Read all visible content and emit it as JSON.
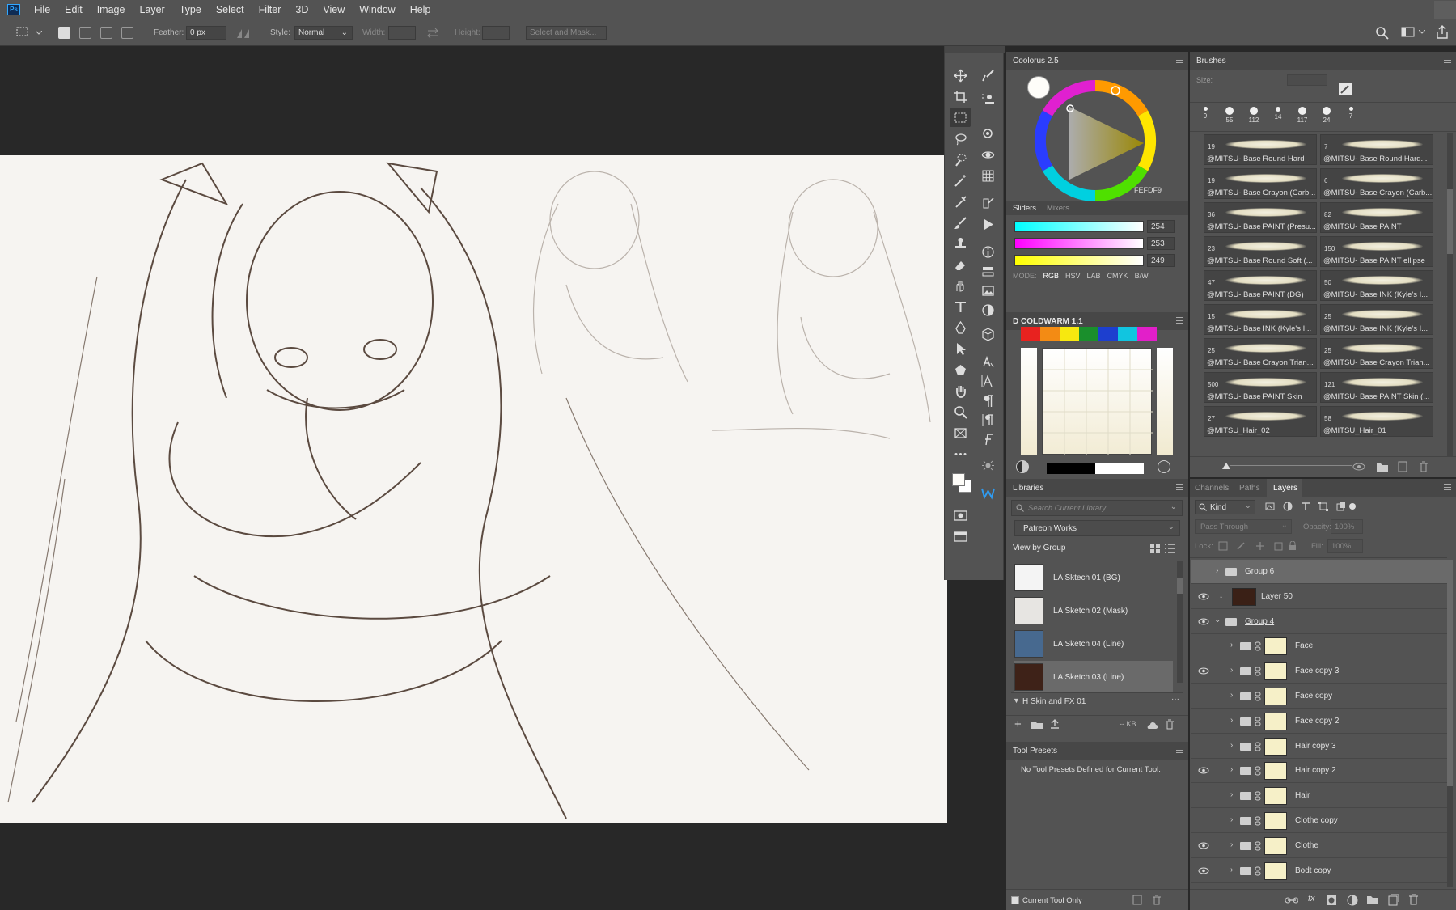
{
  "app": {
    "logo": "Ps"
  },
  "menu": [
    "File",
    "Edit",
    "Image",
    "Layer",
    "Type",
    "Select",
    "Filter",
    "3D",
    "View",
    "Window",
    "Help"
  ],
  "options": {
    "feather_label": "Feather:",
    "feather_value": "0 px",
    "style_label": "Style:",
    "style_value": "Normal",
    "width_label": "Width:",
    "height_label": "Height:",
    "mask_button": "Select and Mask..."
  },
  "tools_left": [
    "move-tool",
    "crop-tool",
    "marquee-tool",
    "lasso-tool",
    "quick-select-tool",
    "magic-wand-tool",
    "eyedropper-tool",
    "brush-tool",
    "stamp-tool",
    "eraser-tool",
    "smudge-tool",
    "type-tool",
    "pen-tool",
    "path-select-tool",
    "shape-tool",
    "hand-tool",
    "zoom-tool",
    "frame-tool",
    "extra-tools"
  ],
  "colorpanel": {
    "title": "Coolorus 2.5",
    "hex": "FEFDF9",
    "tabs": [
      "Sliders",
      "Mixers"
    ],
    "sliders": [
      {
        "label": "R",
        "value": "254"
      },
      {
        "label": "G",
        "value": "253"
      },
      {
        "label": "B",
        "value": "249"
      }
    ],
    "mode_label": "MODE:",
    "modes": [
      "RGB",
      "HSV",
      "LAB",
      "CMYK",
      "B/W"
    ],
    "coldwarm_title": "D COLDWARM 1.1",
    "swatches": [
      "#e8221f",
      "#f38b14",
      "#f7e80f",
      "#1a8f2c",
      "#1d3fcf",
      "#11c5e0",
      "#e21fc9"
    ]
  },
  "brushes": {
    "title": "Brushes",
    "size_label": "Size:",
    "presets": [
      "9",
      "55",
      "112",
      "14",
      "117",
      "24",
      "7"
    ],
    "tiles": [
      {
        "size": "19",
        "name": "@MITSU- Base  Round Hard"
      },
      {
        "size": "7",
        "name": "@MITSU- Base  Round Hard..."
      },
      {
        "size": "19",
        "name": "@MITSU- Base Crayon (Carb..."
      },
      {
        "size": "6",
        "name": "@MITSU- Base Crayon (Carb..."
      },
      {
        "size": "36",
        "name": "@MITSU- Base PAINT (Presu..."
      },
      {
        "size": "82",
        "name": "@MITSU- Base PAINT"
      },
      {
        "size": "23",
        "name": "@MITSU- Base  Round Soft (..."
      },
      {
        "size": "150",
        "name": "@MITSU- Base PAINT ellipse"
      },
      {
        "size": "47",
        "name": "@MITSU- Base PAINT (DG)"
      },
      {
        "size": "50",
        "name": "@MITSU- Base INK (Kyle's I..."
      },
      {
        "size": "15",
        "name": "@MITSU- Base INK (Kyle's I..."
      },
      {
        "size": "25",
        "name": "@MITSU- Base INK (Kyle's I..."
      },
      {
        "size": "25",
        "name": "@MITSU- Base Crayon Trian..."
      },
      {
        "size": "25",
        "name": "@MITSU- Base Crayon Trian..."
      },
      {
        "size": "500",
        "name": "@MITSU- Base PAINT Skin"
      },
      {
        "size": "121",
        "name": "@MITSU- Base PAINT Skin (..."
      },
      {
        "size": "27",
        "name": "@MITSU_Hair_02"
      },
      {
        "size": "58",
        "name": "@MITSU_Hair_01"
      }
    ]
  },
  "libraries": {
    "title": "Libraries",
    "search_placeholder": "Search Current Library",
    "library_name": "Patreon Works",
    "view_label": "View by Group",
    "items": [
      {
        "name": "LA Sktech 01 (BG)",
        "color": "#f4f4f4"
      },
      {
        "name": "LA Sketch 02 (Mask)",
        "color": "#e7e5e2"
      },
      {
        "name": "LA Sketch 04 (Line)",
        "color": "#47698f"
      },
      {
        "name": "LA Sketch 03 (Line)",
        "color": "#3e2218"
      }
    ],
    "group": "H Skin and FX 01",
    "size_text": "-- KB"
  },
  "toolpresets": {
    "title": "Tool Presets",
    "message": "No Tool Presets Defined for Current Tool.",
    "checkbox_label": "Current Tool Only"
  },
  "layers": {
    "tabs": [
      "Channels",
      "Paths",
      "Layers"
    ],
    "filter_kind": "Kind",
    "blend_mode": "Pass Through",
    "opacity_label": "Opacity:",
    "opacity_value": "100%",
    "lock_label": "Lock:",
    "fill_label": "Fill:",
    "fill_value": "100%",
    "rows": [
      {
        "name": "Group 6",
        "type": "group",
        "visible": false
      },
      {
        "name": "Layer 50",
        "type": "layer",
        "visible": true
      },
      {
        "name": "Group 4",
        "type": "group-open",
        "visible": true
      },
      {
        "name": "Face",
        "type": "sub",
        "visible": false
      },
      {
        "name": "Face copy 3",
        "type": "sub",
        "visible": true
      },
      {
        "name": "Face copy",
        "type": "sub",
        "visible": false
      },
      {
        "name": "Face copy 2",
        "type": "sub",
        "visible": false
      },
      {
        "name": "Hair copy 3",
        "type": "sub",
        "visible": false
      },
      {
        "name": "Hair copy 2",
        "type": "sub",
        "visible": true
      },
      {
        "name": "Hair",
        "type": "sub",
        "visible": false
      },
      {
        "name": "Clothe copy",
        "type": "sub",
        "visible": false
      },
      {
        "name": "Clothe",
        "type": "sub",
        "visible": true
      },
      {
        "name": "Bodt copy",
        "type": "sub",
        "visible": true
      }
    ]
  }
}
